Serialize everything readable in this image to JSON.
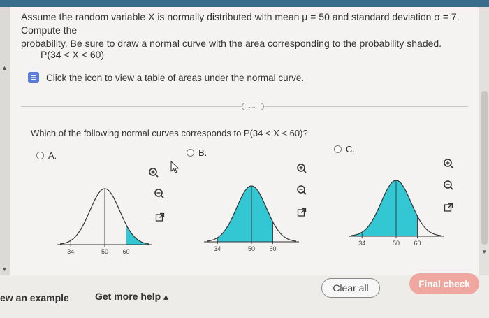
{
  "question": {
    "line1": "Assume the random variable X is normally distributed with mean μ = 50 and standard deviation σ = 7. Compute the",
    "line2": "probability. Be sure to draw a normal curve with the area corresponding to the probability shaded.",
    "expression": "P(34 < X < 60)"
  },
  "help": {
    "text": "Click the icon to view a table of areas under the normal curve.",
    "icon": "table-icon"
  },
  "separator": {
    "label": "....."
  },
  "prompt": {
    "text": "Which of the following normal curves corresponds to P(34 < X < 60)?"
  },
  "options": [
    {
      "label": "A.",
      "ticks": [
        "34",
        "50",
        "60"
      ],
      "tick_values": [
        34,
        50,
        60
      ],
      "shade": [
        60,
        71
      ]
    },
    {
      "label": "B.",
      "ticks": [
        "34",
        "50",
        "60"
      ],
      "tick_values": [
        34,
        50,
        60
      ],
      "shade": [
        34,
        60
      ]
    },
    {
      "label": "C.",
      "ticks": [
        "34",
        "50",
        "60"
      ],
      "tick_values": [
        34,
        50,
        60
      ],
      "shade": [
        29,
        60
      ]
    }
  ],
  "curve": {
    "mean": 50,
    "sd": 7,
    "domain": [
      29,
      71
    ],
    "fill_color": "#33c6d3",
    "line_color": "#333333"
  },
  "footer": {
    "view_example": "ew an example",
    "get_more_help": "Get more help ▴",
    "clear_all": "Clear all",
    "final_check": "Final check"
  },
  "icons": [
    "zoom-in-icon",
    "zoom-out-icon",
    "open-new-window-icon",
    "mouse-cursor-icon"
  ]
}
